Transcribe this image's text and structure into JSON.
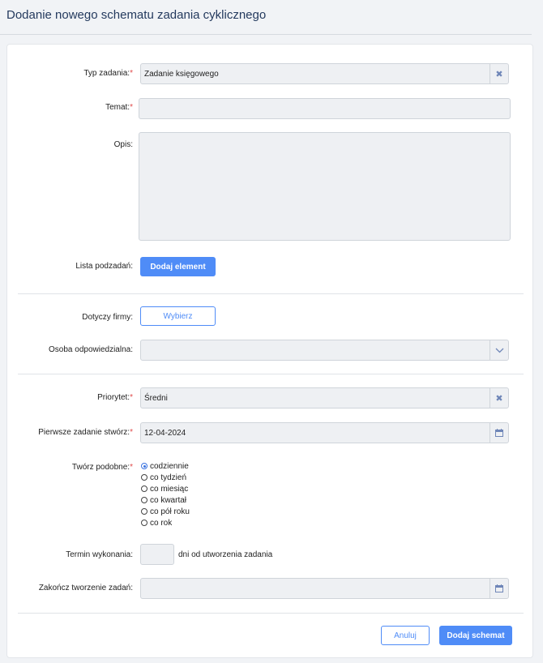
{
  "header": {
    "title": "Dodanie nowego schematu zadania cyklicznego"
  },
  "form": {
    "task_type": {
      "label": "Typ zadania:",
      "required_mark": "*",
      "value": "Zadanie księgowego",
      "clear_icon": "close-icon"
    },
    "subject": {
      "label": "Temat:",
      "required_mark": "*",
      "value": ""
    },
    "description": {
      "label": "Opis:",
      "value": ""
    },
    "subtasks": {
      "label": "Lista podzadań:",
      "button": "Dodaj element"
    },
    "company": {
      "label": "Dotyczy firmy:",
      "button": "Wybierz"
    },
    "responsible": {
      "label": "Osoba odpowiedzialna:",
      "value": "",
      "icon": "chevron-down-icon"
    },
    "priority": {
      "label": "Priorytet:",
      "required_mark": "*",
      "value": "Średni",
      "clear_icon": "close-icon"
    },
    "first_task": {
      "label": "Pierwsze zadanie stwórz:",
      "required_mark": "*",
      "value": "12-04-2024",
      "icon": "calendar-icon"
    },
    "recurrence": {
      "label": "Twórz podobne:",
      "required_mark": "*",
      "options": [
        "codziennie",
        "co tydzień",
        "co miesiąc",
        "co kwartał",
        "co pół roku",
        "co rok"
      ],
      "selected": "codziennie"
    },
    "deadline": {
      "label": "Termin wykonania:",
      "value": "",
      "suffix": "dni od utworzenia zadania"
    },
    "end_creation": {
      "label": "Zakończ tworzenie zadań:",
      "value": "",
      "icon": "calendar-icon"
    }
  },
  "footer": {
    "cancel": "Anuluj",
    "submit": "Dodaj schemat"
  },
  "colors": {
    "accent": "#4f8cf7",
    "required": "#e04a4a",
    "title": "#243a5e"
  }
}
